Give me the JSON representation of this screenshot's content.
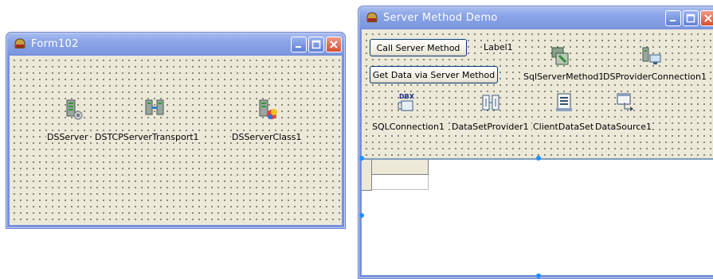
{
  "form102": {
    "title": "Form102",
    "components": {
      "ds_server": "DSServer",
      "tcp_transport": "DSTCPServerTransport1",
      "server_class": "DSServerClass1"
    }
  },
  "demo": {
    "title": "Server Method Demo",
    "buttons": {
      "call": "Call Server Method",
      "get_data": "Get Data via Server Method"
    },
    "label1": "Label1",
    "components": {
      "sql_server_method": "SqlServerMethod1",
      "provider_connection": "DSProviderConnection1",
      "sql_connection": "SQLConnection1",
      "dataset_provider": "DataSetProvider1",
      "client_dataset": "ClientDataSet1",
      "data_source": "DataSource1"
    },
    "dbx_text": "DBX"
  },
  "colors": {
    "titlebar": "#7c98e0",
    "client": "#ece9d8",
    "close": "#d64f2f"
  }
}
